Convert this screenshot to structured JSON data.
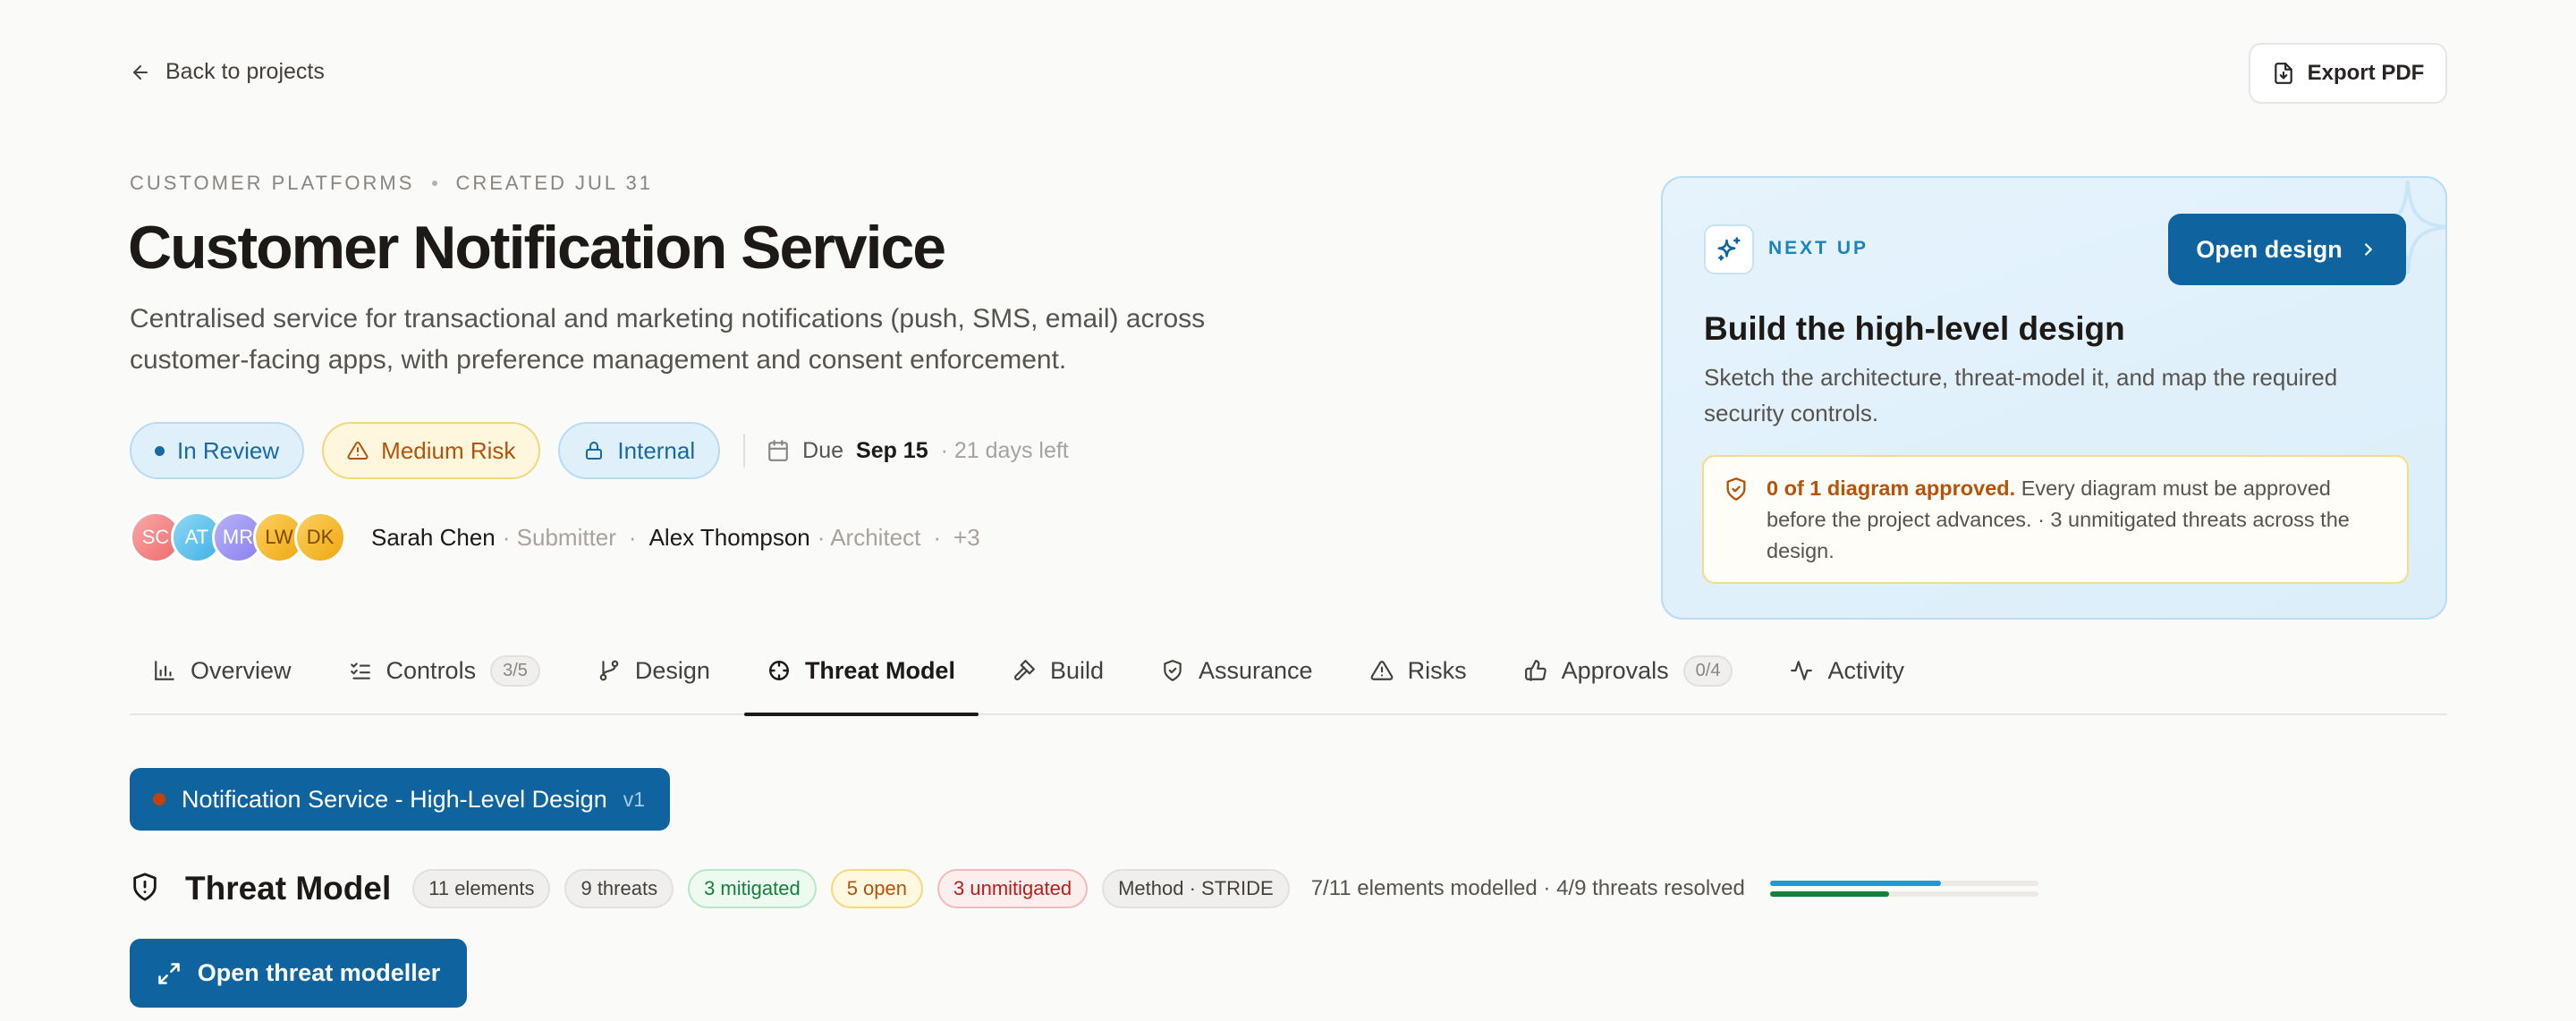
{
  "nav": {
    "back_label": "Back to projects",
    "export_label": "Export PDF"
  },
  "project": {
    "org": "CUSTOMER PLATFORMS",
    "created": "CREATED JUL 31",
    "title": "Customer Notification Service",
    "description": "Centralised service for transactional and marketing notifications (push, SMS, email) across customer-facing apps, with preference management and consent enforcement.",
    "status": "In Review",
    "risk": "Medium Risk",
    "classification": "Internal",
    "due_label": "Due",
    "due_date": "Sep 15",
    "due_remaining": "· 21 days left"
  },
  "people": {
    "avatars": [
      "SC",
      "AT",
      "MR",
      "LW",
      "DK"
    ],
    "submitter_name": "Sarah Chen",
    "submitter_role": "· Submitter",
    "architect_name": "Alex Thompson",
    "architect_role": "· Architect",
    "more": "+3"
  },
  "next_up": {
    "label": "NEXT UP",
    "button": "Open design",
    "title": "Build the high-level design",
    "description": "Sketch the architecture, threat-model it, and map the required security controls.",
    "warning_strong": "0 of 1 diagram approved.",
    "warning_text": "Every diagram must be approved before the project advances. · 3 unmitigated threats across the design."
  },
  "tabs": [
    {
      "label": "Overview",
      "count": null
    },
    {
      "label": "Controls",
      "count": "3/5"
    },
    {
      "label": "Design",
      "count": null
    },
    {
      "label": "Threat Model",
      "count": null
    },
    {
      "label": "Build",
      "count": null
    },
    {
      "label": "Assurance",
      "count": null
    },
    {
      "label": "Risks",
      "count": null
    },
    {
      "label": "Approvals",
      "count": "0/4"
    },
    {
      "label": "Activity",
      "count": null
    }
  ],
  "active_tab": "Threat Model",
  "diagram": {
    "name": "Notification Service - High-Level Design",
    "version": "v1"
  },
  "threat_model": {
    "title": "Threat Model",
    "chips": {
      "elements": "11 elements",
      "threats": "9 threats",
      "mitigated": "3 mitigated",
      "open": "5 open",
      "unmitigated": "3 unmitigated",
      "method": "Method · STRIDE"
    },
    "stats": "7/11 elements modelled · 4/9 threats resolved",
    "elements_progress": 0.636,
    "threats_progress": 0.444,
    "open_button": "Open threat modeller"
  },
  "colors": {
    "primary": "#0f64a0",
    "accent": "#1e9bd7",
    "warning": "#b45309",
    "success": "#15803d",
    "danger": "#b91c1c"
  }
}
